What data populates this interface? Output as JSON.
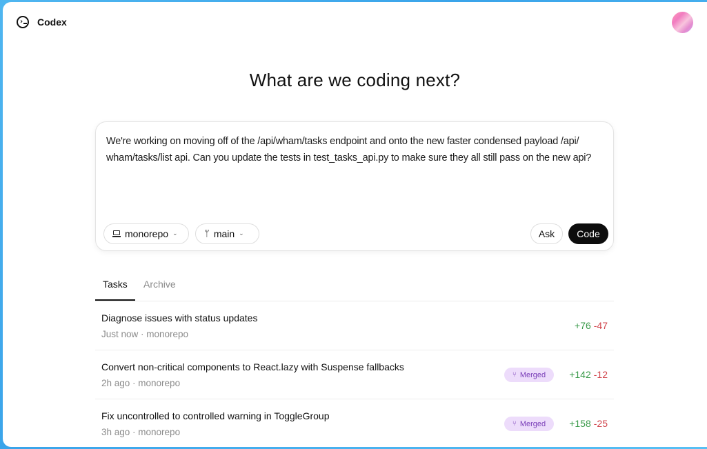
{
  "app": {
    "name": "Codex"
  },
  "page": {
    "title": "What are we coding next?"
  },
  "composer": {
    "prompt": "We're working on moving off of the /api/wham/tasks endpoint and onto the new faster condensed payload /api/ wham/tasks/list api. Can you update the tests in test_tasks_api.py to make sure they all still pass on the new api?",
    "environment": "monorepo",
    "branch": "main",
    "ask_label": "Ask",
    "code_label": "Code"
  },
  "tabs": [
    {
      "label": "Tasks",
      "active": true
    },
    {
      "label": "Archive",
      "active": false
    }
  ],
  "tasks": [
    {
      "title": "Diagnose issues with status updates",
      "meta": "Just now · monorepo",
      "badge": "",
      "additions": "+76",
      "deletions": "-47"
    },
    {
      "title": "Convert non-critical components to React.lazy with Suspense fallbacks",
      "meta": "2h ago · monorepo",
      "badge": "Merged",
      "additions": "+142",
      "deletions": "-12"
    },
    {
      "title": "Fix uncontrolled to controlled warning in ToggleGroup",
      "meta": "3h ago · monorepo",
      "badge": "Merged",
      "additions": "+158",
      "deletions": "-25"
    }
  ],
  "colors": {
    "accent": "#0d0d0d",
    "additions": "#3a9a4a",
    "deletions": "#d0454c",
    "badge_bg": "#eddcfb",
    "badge_text": "#7a3fb8"
  },
  "icons": {
    "logo": "terminal-circle-icon",
    "environment": "laptop-icon",
    "branch": "git-branch-icon",
    "merged": "git-merge-icon"
  }
}
